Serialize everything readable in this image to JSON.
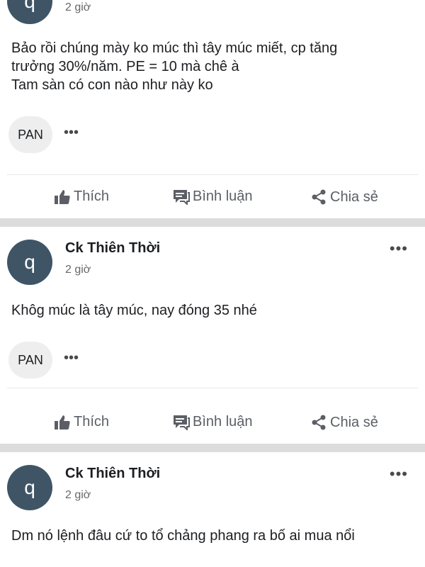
{
  "posts": [
    {
      "avatar_letter": "q",
      "author": "",
      "time": "2 giờ",
      "lines": [
        "Bảo rồi chúng mày ko múc thì tây múc miết, cp tăng",
        "trưởng 30%/năm. PE = 10 mà chê à",
        "Tam sàn có con nào như này ko"
      ],
      "tag": "PAN",
      "tag_more": "•••"
    },
    {
      "avatar_letter": "q",
      "author": "Ck Thiên Thời",
      "time": "2 giờ",
      "more": "•••",
      "lines": [
        "Khôg múc là tây múc, nay đóng 35 nhé"
      ],
      "tag": "PAN",
      "tag_more": "•••"
    },
    {
      "avatar_letter": "q",
      "author": "Ck Thiên Thời",
      "time": "2 giờ",
      "more": "•••",
      "lines": [
        "Dm nó lệnh đâu cứ to tổ chảng phang ra bố ai mua nổi"
      ]
    }
  ],
  "actions": {
    "like": "Thích",
    "comment": "Bình luận",
    "share": "Chia sẻ"
  }
}
